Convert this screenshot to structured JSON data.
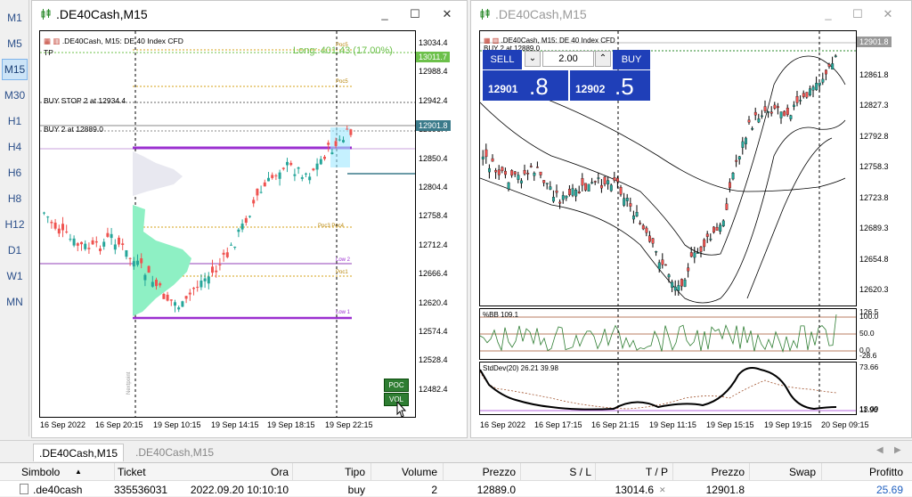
{
  "timeframes": [
    "M1",
    "M5",
    "M15",
    "M30",
    "H1",
    "H4",
    "H6",
    "H8",
    "H12",
    "D1",
    "W1",
    "MN"
  ],
  "active_timeframe": "M15",
  "window_left": {
    "title": ".DE40Cash,M15",
    "chart_header": ".DE40Cash, M15:  DE 40 Index CFD",
    "tp_label": "TP",
    "long_label": "Long: 401.43  (17.00%)",
    "buy_stop_label": "BUY STOP 2 at 12934.4",
    "buy_label": "BUY 2 at 12889.0",
    "price_labels": [
      "13034.4",
      "12988.4",
      "12942.4",
      "12896.4",
      "12850.4",
      "12804.4",
      "12758.4",
      "12712.4",
      "12666.4",
      "12620.4",
      "12574.4",
      "12528.4",
      "12482.4"
    ],
    "price_tag_green": "13011.7",
    "price_tag_current": "12901.8",
    "time_labels": [
      "16 Sep 2022",
      "16 Sep 20:15",
      "19 Sep 10:15",
      "19 Sep 14:15",
      "19 Sep 18:15",
      "19 Sep 22:15"
    ],
    "poc_button": "POC",
    "vol_button": "VOL",
    "profile_labels": {
      "poc5": "Poc5",
      "poc3_4": "Poc3 Poc4",
      "low2": "Low 2",
      "poc1": "Poc1",
      "low1": "Low 1",
      "nextpoint": "Nextpoint"
    }
  },
  "window_right": {
    "title": ".DE40Cash,M15",
    "chart_header": ".DE40Cash, M15:  DE 40 Index CFD",
    "buy_line_label": "BUY 2 at 12889.0",
    "trade": {
      "sell_label": "SELL",
      "buy_label": "BUY",
      "volume": "2.00",
      "bid_main": "12901",
      "bid_frac": ".8",
      "ask_main": "12902",
      "ask_frac": ".5"
    },
    "price_labels": [
      "12896.4",
      "12861.8",
      "12827.3",
      "12792.8",
      "12758.3",
      "12723.8",
      "12689.3",
      "12654.8",
      "12620.3"
    ],
    "price_tag_current": "12901.8",
    "bb_title": "%BB 109.1",
    "bb_labels": [
      "126.5",
      "100.0",
      "50.0",
      "0.0",
      "-28.6"
    ],
    "sd_title": "StdDev(20) 26.21 39.98",
    "sd_labels": [
      "73.66",
      "13.09",
      "11.90"
    ],
    "time_labels": [
      "16 Sep 2022",
      "16 Sep 17:15",
      "16 Sep 21:15",
      "19 Sep 11:15",
      "19 Sep 15:15",
      "19 Sep 19:15",
      "20 Sep 09:15"
    ]
  },
  "tabs": [
    ".DE40Cash,M15",
    ".DE40Cash,M15"
  ],
  "positions": {
    "headers": [
      "Simbolo",
      "Ticket",
      "Ora",
      "Tipo",
      "Volume",
      "Prezzo",
      "S / L",
      "T / P",
      "Prezzo",
      "Swap",
      "Profitto"
    ],
    "rows": [
      {
        "symbol": ".de40cash",
        "ticket": "335536031",
        "time": "2022.09.20 10:10:10",
        "type": "buy",
        "volume": "2",
        "price": "12889.0",
        "sl": "",
        "tp": "13014.6",
        "price_now": "12901.8",
        "swap": "",
        "profit": "25.69"
      }
    ]
  },
  "colors": {
    "bull": "#26a69a",
    "bear": "#ef5350",
    "profile_green": "#8ef0c4",
    "purple": "#9b30d0",
    "trade_blue": "#1f3fb8",
    "profit_blue": "#2060c0"
  }
}
